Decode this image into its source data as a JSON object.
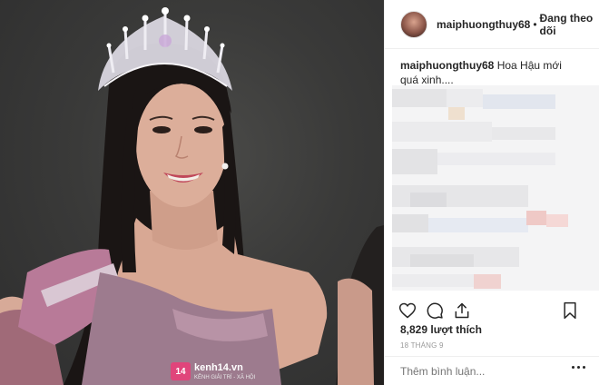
{
  "post": {
    "username": "maiphuongthuy68",
    "separator": "•",
    "follow_status": "Đang theo dõi",
    "caption_user": "maiphuongthuy68",
    "caption_text": "Hoa Hậu mới quá xinh....",
    "likes": "8,829 lượt thích",
    "date": "18 THÁNG 9",
    "comment_placeholder": "Thêm bình luận..."
  },
  "watermark": {
    "badge": "14",
    "site": "kenh14.vn",
    "tagline": "KÊNH GIẢI TRÍ - XÃ HỘI"
  },
  "icons": {
    "like": "heart-icon",
    "comment": "comment-icon",
    "share": "share-icon",
    "save": "bookmark-icon",
    "more": "more-icon"
  },
  "colors": {
    "text": "#262626",
    "muted": "#999999",
    "border": "#efefef",
    "photo_bg": "#3a3a39"
  }
}
